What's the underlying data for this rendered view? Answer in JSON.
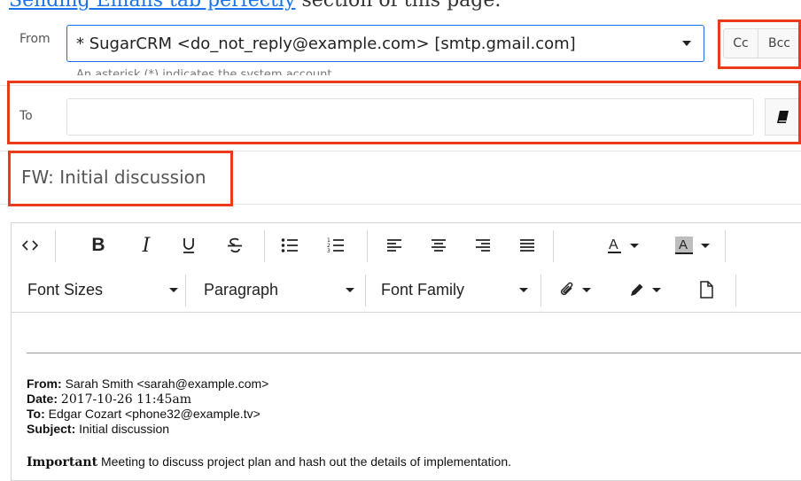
{
  "top_text": {
    "link": "Sending Emails tab perfectly",
    "rest": " section of this page."
  },
  "from": {
    "label": "From",
    "value": "* SugarCRM <do_not_reply@example.com> [smtp.gmail.com]",
    "hint": "An asterisk (*) indicates the system account."
  },
  "cc_label": "Cc",
  "bcc_label": "Bcc",
  "to": {
    "label": "To",
    "value": ""
  },
  "subject": "FW: Initial discussion",
  "toolbar": {
    "font_sizes": "Font Sizes",
    "paragraph": "Paragraph",
    "font_family": "Font Family"
  },
  "body": {
    "from_label": "From:",
    "from_value": "Sarah Smith <sarah@example.com>",
    "date_label": "Date:",
    "date_value": "2017-10-26 11:45am",
    "to_label": "To:",
    "to_value": "Edgar Cozart <phone32@example.tv>",
    "subject_label": "Subject:",
    "subject_value": "Initial discussion",
    "important_label": "Important",
    "important_text": "Meeting to discuss project plan and hash out the details of implementation."
  },
  "colors": {
    "highlight": "#ea3a1c",
    "accent": "#176de5"
  }
}
